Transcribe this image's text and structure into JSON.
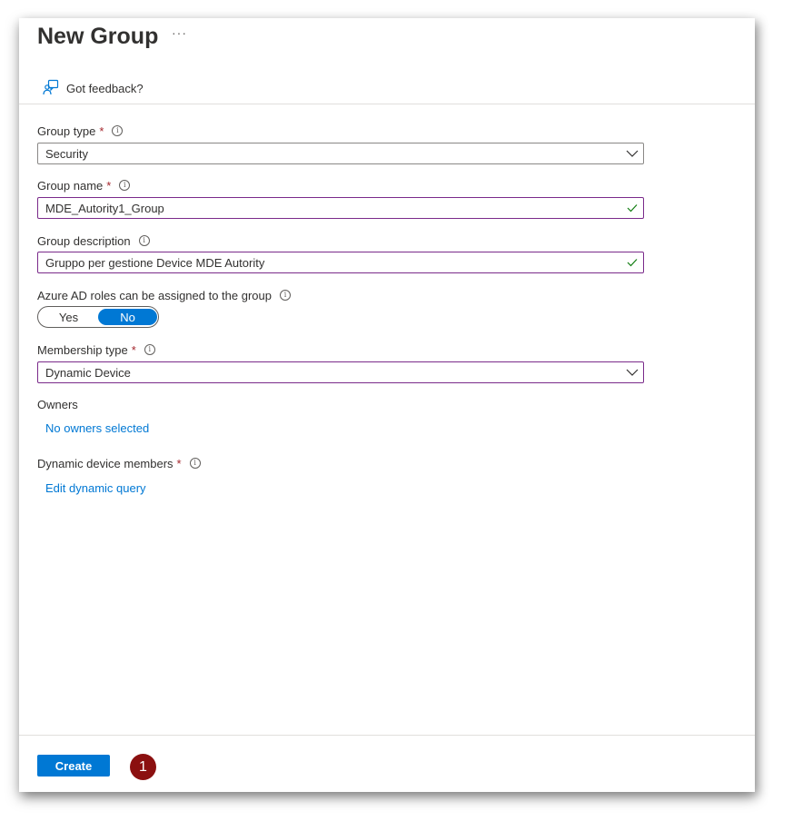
{
  "header": {
    "title": "New Group",
    "more_label": "···",
    "feedback_label": "Got feedback?"
  },
  "form": {
    "group_type": {
      "label": "Group type",
      "required": "*",
      "value": "Security"
    },
    "group_name": {
      "label": "Group name",
      "required": "*",
      "value": "MDE_Autority1_Group"
    },
    "group_description": {
      "label": "Group description",
      "value": "Gruppo per gestione Device MDE Autority"
    },
    "azure_ad_roles": {
      "label": "Azure AD roles can be assigned to the group",
      "yes": "Yes",
      "no": "No",
      "selected": "No"
    },
    "membership_type": {
      "label": "Membership type",
      "required": "*",
      "value": "Dynamic Device"
    },
    "owners": {
      "label": "Owners",
      "link": "No owners selected"
    },
    "dynamic_members": {
      "label": "Dynamic device members",
      "required": "*",
      "link": "Edit dynamic query"
    }
  },
  "footer": {
    "create_label": "Create",
    "step_badge": "1"
  },
  "colors": {
    "accent": "#0078d4",
    "required": "#a4262c",
    "valid_check": "#107c10",
    "focused_border": "#7a2a8a",
    "step_badge": "#8b1010"
  },
  "icons": {
    "feedback": "feedback-person-icon",
    "info": "info-icon",
    "dropdown": "chevron-down-icon",
    "valid": "checkmark-icon"
  }
}
